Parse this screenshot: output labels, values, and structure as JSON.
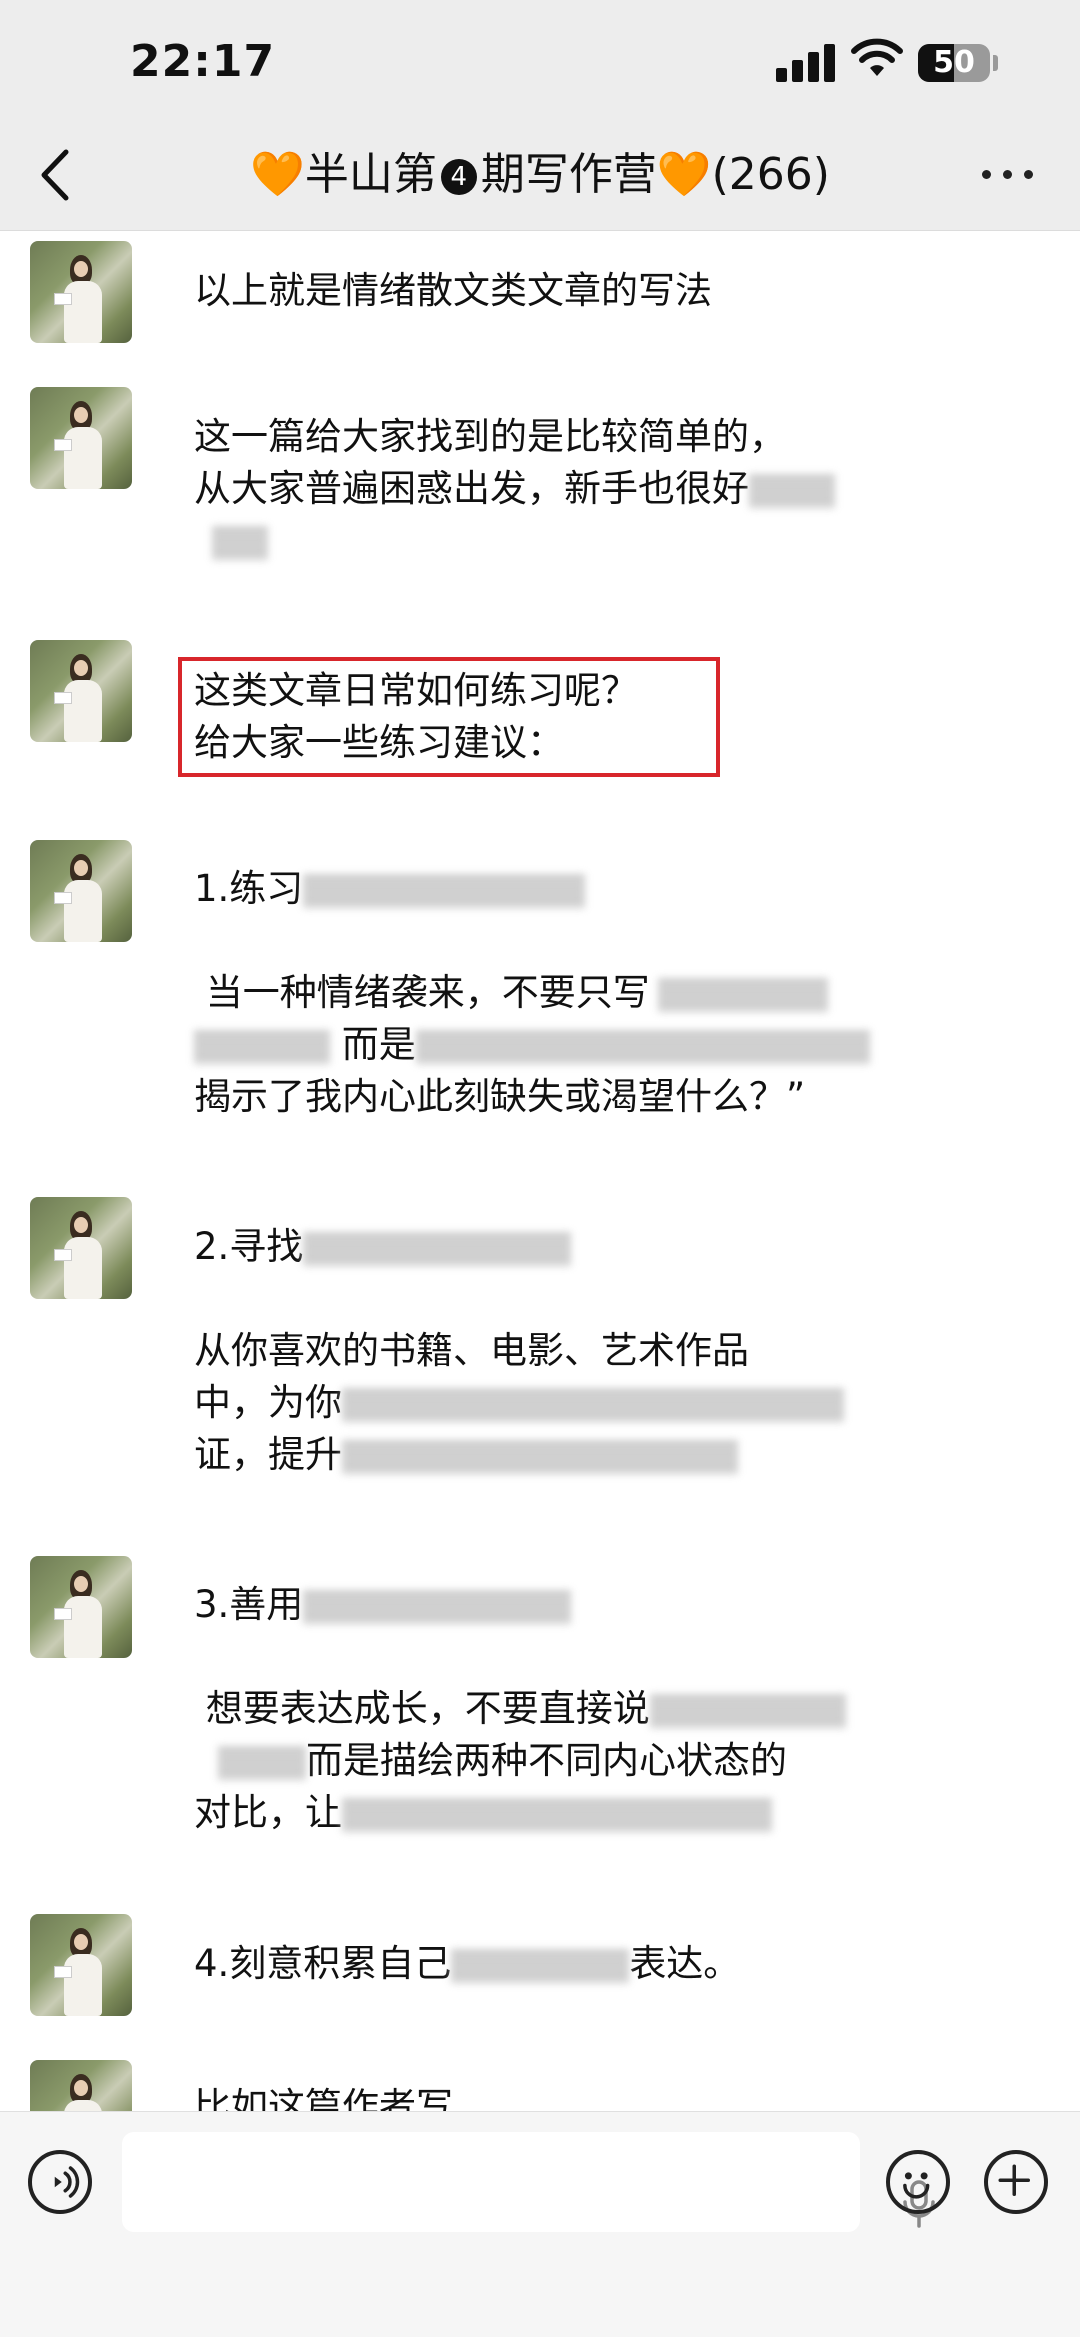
{
  "status_bar": {
    "time": "22:17",
    "battery": "50"
  },
  "nav": {
    "title_prefix": "🧡半山第",
    "issue_number": "4",
    "title_suffix": "期写作营🧡",
    "member_count": "(266)"
  },
  "messages": [
    {
      "lines": [
        "以上就是情绪散文类文章的写法"
      ]
    },
    {
      "lines": [
        "这一篇给大家找到的是比较简单的，",
        "从大家普遍困惑出发，新手也很好"
      ]
    },
    {
      "lines": [
        "这类文章日常如何练习呢？",
        "给大家一些练习建议："
      ]
    },
    {
      "lines": [
        "1.练习",
        "",
        " 当一种情绪袭来，不要只写",
        "而是",
        "揭示了我内心此刻缺失或渴望什么？”"
      ]
    },
    {
      "lines": [
        "2.寻找",
        "",
        "从你喜欢的书籍、电影、艺术作品",
        "中，为你",
        "证，提升"
      ]
    },
    {
      "lines": [
        "3.善用",
        "",
        " 想要表达成长，不要直接说",
        "而是描绘两种不同内心状态的",
        "对比，让"
      ]
    },
    {
      "lines": [
        "4.刻意积累自己",
        "表达。"
      ]
    },
    {
      "lines": [
        "比如这篇作者写"
      ]
    }
  ],
  "icons": {
    "back": "chevron-left-icon",
    "more": "more-dots-icon",
    "voice": "voice-icon",
    "mic": "microphone-icon",
    "emoji": "emoji-icon",
    "add": "plus-icon"
  },
  "colors": {
    "highlight_box": "#d8262b",
    "heart": "#f28a1d"
  }
}
